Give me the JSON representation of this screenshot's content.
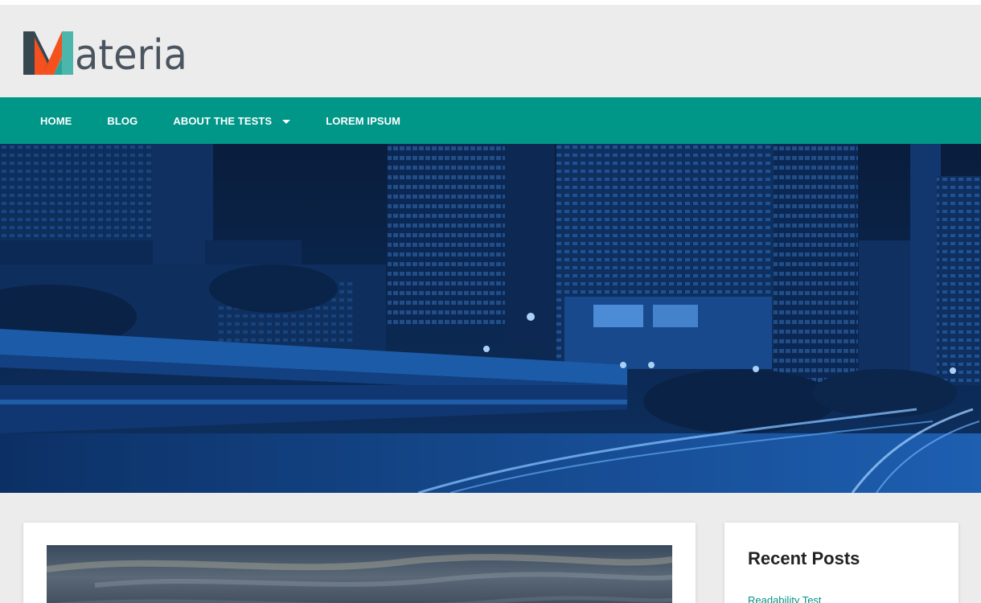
{
  "brand": {
    "logo_text": "ateria",
    "logo_alt": "Materia",
    "logo_colors": [
      "#37474f",
      "#f4511e",
      "#4db6ac"
    ]
  },
  "nav": {
    "background": "#009688",
    "items": [
      {
        "label": "HOME"
      },
      {
        "label": "BLOG"
      },
      {
        "label": "ABOUT THE TESTS",
        "has_dropdown": true
      },
      {
        "label": "LOREM IPSUM"
      }
    ]
  },
  "hero": {
    "image": "city-night-skyline-icon",
    "tint": "#1565c0"
  },
  "sidebar": {
    "widget_title": "Recent Posts",
    "recent_posts": [
      "Readability Test"
    ]
  },
  "post": {
    "thumbnail": "sunset-sky-icon"
  }
}
